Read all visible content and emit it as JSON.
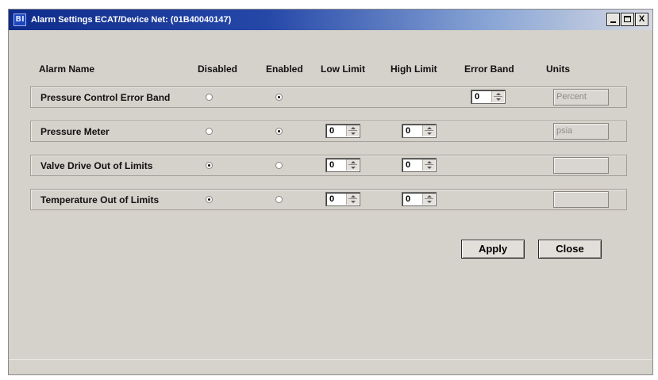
{
  "window": {
    "title": "Alarm Settings ECAT/Device Net: (01B40040147)",
    "icon_text": "BI",
    "controls": {
      "minimize_icon": "minimize-icon",
      "maximize_icon": "maximize-icon",
      "close_label": "X"
    }
  },
  "headers": {
    "alarm_name": "Alarm Name",
    "disabled": "Disabled",
    "enabled": "Enabled",
    "low_limit": "Low Limit",
    "high_limit": "High Limit",
    "error_band": "Error Band",
    "units": "Units"
  },
  "alarms": [
    {
      "name": "Pressure Control Error Band",
      "disabled": false,
      "enabled": true,
      "error_band": "0",
      "units": "Percent"
    },
    {
      "name": "Pressure Meter",
      "disabled": false,
      "enabled": true,
      "low_limit": "0",
      "high_limit": "0",
      "units": "psia"
    },
    {
      "name": "Valve Drive Out of Limits",
      "disabled": true,
      "enabled": false,
      "low_limit": "0",
      "high_limit": "0",
      "units": ""
    },
    {
      "name": "Temperature Out of Limits",
      "disabled": true,
      "enabled": false,
      "low_limit": "0",
      "high_limit": "0",
      "units": ""
    }
  ],
  "buttons": {
    "apply": "Apply",
    "close": "Close"
  }
}
